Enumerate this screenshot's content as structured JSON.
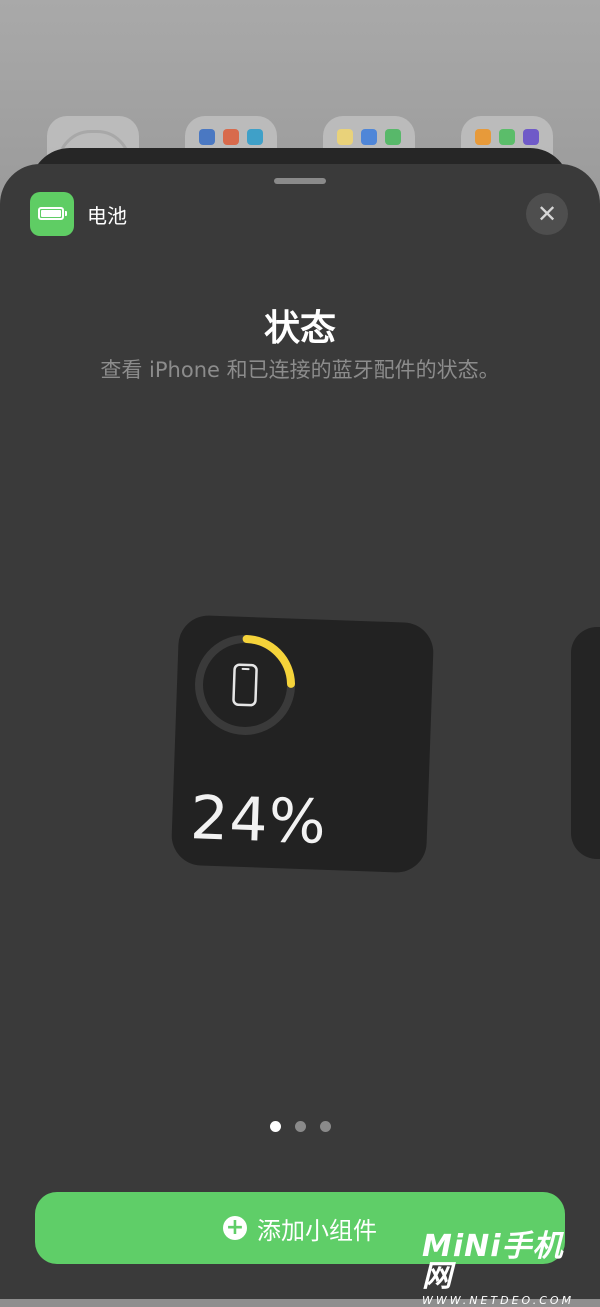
{
  "header": {
    "app_name": "电池",
    "close_symbol": "✕"
  },
  "widget_info": {
    "title": "状态",
    "description": "查看 iPhone 和已连接的蓝牙配件的状态。"
  },
  "battery_widget": {
    "device_icon": "iphone-icon",
    "level_percent": 24,
    "level_text": "24%",
    "ring_color": "#f5d33a",
    "track_color": "#3a3a3a"
  },
  "pagination": {
    "total": 3,
    "active_index": 0
  },
  "actions": {
    "add_label": "添加小组件",
    "add_icon": "plus-circle-icon",
    "accent_color": "#5fce68"
  },
  "watermark": {
    "brand": "MiNi手机网",
    "site": "WWW.NETDEO.COM"
  }
}
